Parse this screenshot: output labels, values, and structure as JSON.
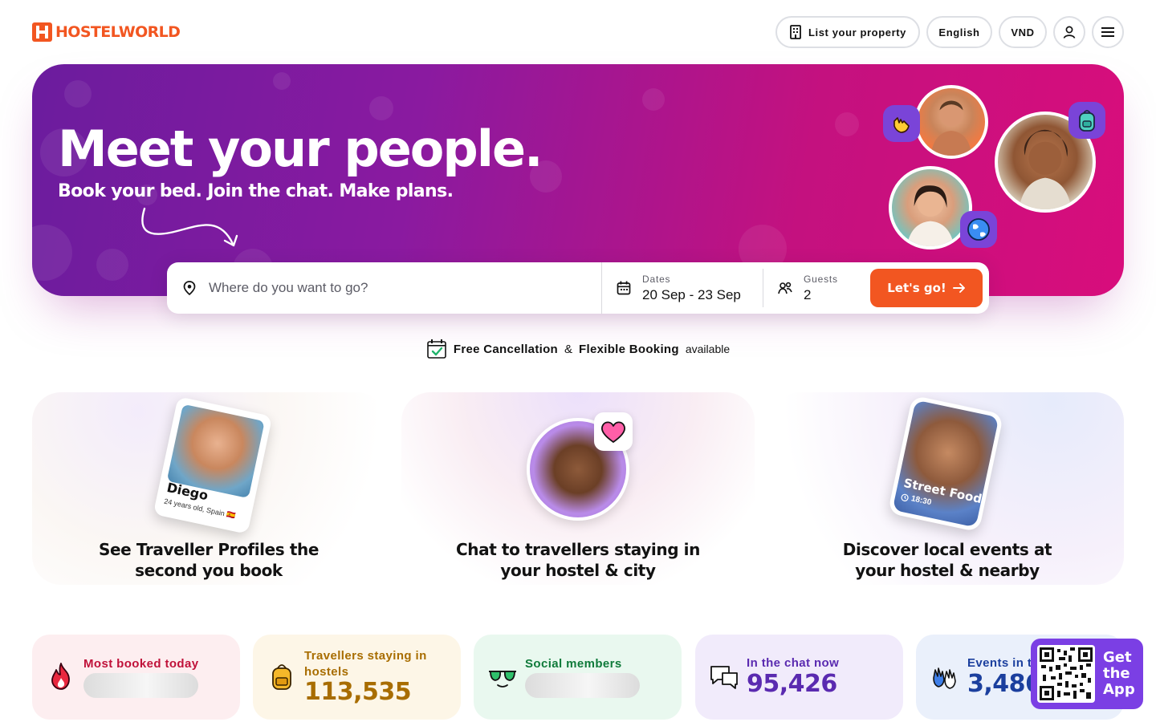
{
  "header": {
    "logo_text": "HOSTELWORLD",
    "list_property": "List your property",
    "language": "English",
    "currency": "VND",
    "account_icon": "user-icon",
    "menu_icon": "hamburger-menu-icon"
  },
  "hero": {
    "title": "Meet your people.",
    "subtitle": "Book your bed. Join the chat. Make plans."
  },
  "search": {
    "where_placeholder": "Where do you want to go?",
    "dates_label": "Dates",
    "dates_value": "20 Sep - 23 Sep",
    "guests_label": "Guests",
    "guests_value": "2",
    "submit": "Let's go!"
  },
  "notice": {
    "free_cancellation": "Free Cancellation",
    "amp": "&",
    "flexible_booking": "Flexible Booking",
    "available": "available"
  },
  "features": [
    {
      "title": "See Traveller Profiles the second you book",
      "card_name": "Diego",
      "card_meta": "24 years old, Spain 🇪🇸"
    },
    {
      "title": "Chat to travellers staying in your hostel & city"
    },
    {
      "title": "Discover local events at your hostel & nearby",
      "card_event": "Street Food",
      "card_time": "18:30"
    }
  ],
  "stats": [
    {
      "label": "Most booked today",
      "value": "",
      "icon": "fire-icon",
      "color": "#c0123a"
    },
    {
      "label": "Travellers staying in hostels",
      "value": "113,535",
      "icon": "backpack-icon",
      "color": "#a86d00"
    },
    {
      "label": "Social members",
      "value": "",
      "icon": "sunglasses-icon",
      "color": "#0f7a3a"
    },
    {
      "label": "In the chat now",
      "value": "95,426",
      "icon": "chat-bubbles-icon",
      "color": "#5a2ab0"
    },
    {
      "label": "Events in t",
      "value": "3,486",
      "icon": "waving-hands-icon",
      "color": "#1b3f9e"
    }
  ],
  "app_promo": {
    "line1": "Get",
    "line2": "the",
    "line3": "App"
  },
  "colors": {
    "brand_orange": "#f25621",
    "hero_purple": "#6b1c9e",
    "hero_pink": "#d80d7c"
  }
}
